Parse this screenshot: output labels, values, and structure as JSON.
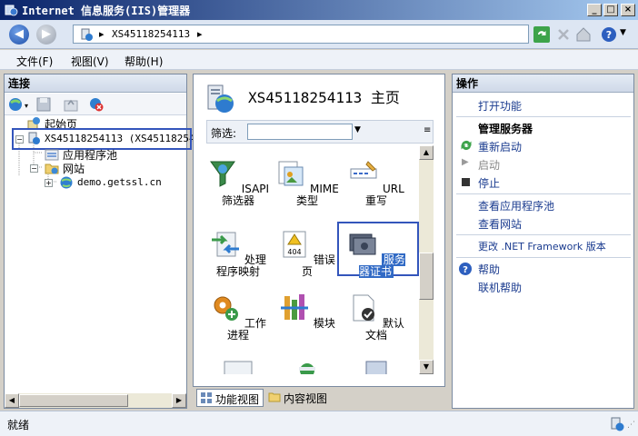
{
  "window": {
    "title": "Internet 信息服务(IIS)管理器",
    "min_label": "_",
    "max_label": "□",
    "close_label": "×"
  },
  "address": {
    "root_arrow": "▸",
    "server": "XS45118254113",
    "trail_arrow": "▸"
  },
  "menu": {
    "file": "文件(F)",
    "view": "视图(V)",
    "help": "帮助(H)"
  },
  "connections": {
    "header": "连接",
    "tree": {
      "start_page": "起始页",
      "server": "XS45118254113 (XS451182541",
      "app_pools": "应用程序池",
      "sites": "网站",
      "site_demo": "demo.getssl.cn"
    }
  },
  "home": {
    "title": "XS45118254113 主页",
    "filter_label": "筛选:",
    "features": [
      {
        "label": "ISAPI 筛选器"
      },
      {
        "label": "MIME 类型"
      },
      {
        "label": "URL 重写"
      },
      {
        "label": "处理程序映射"
      },
      {
        "label": "错误页"
      },
      {
        "label": "服务器证书"
      },
      {
        "label": "工作进程"
      },
      {
        "label": "模块"
      },
      {
        "label": "默认文档"
      }
    ],
    "error_icon_text": "404",
    "tabs": {
      "features_view": "功能视图",
      "content_view": "内容视图"
    }
  },
  "actions": {
    "header": "操作",
    "open_feature": "打开功能",
    "manage_server": "管理服务器",
    "restart": "重新启动",
    "start": "启动",
    "stop": "停止",
    "view_app_pools": "查看应用程序池",
    "view_sites": "查看网站",
    "change_net": "更改 .NET Framework 版本",
    "help": "帮助",
    "online_help": "联机帮助"
  },
  "status": {
    "text": "就绪"
  },
  "colors": {
    "highlight_box": "#3355bb",
    "link_blue": "#1a3b8f",
    "selection": "#316ac5"
  }
}
